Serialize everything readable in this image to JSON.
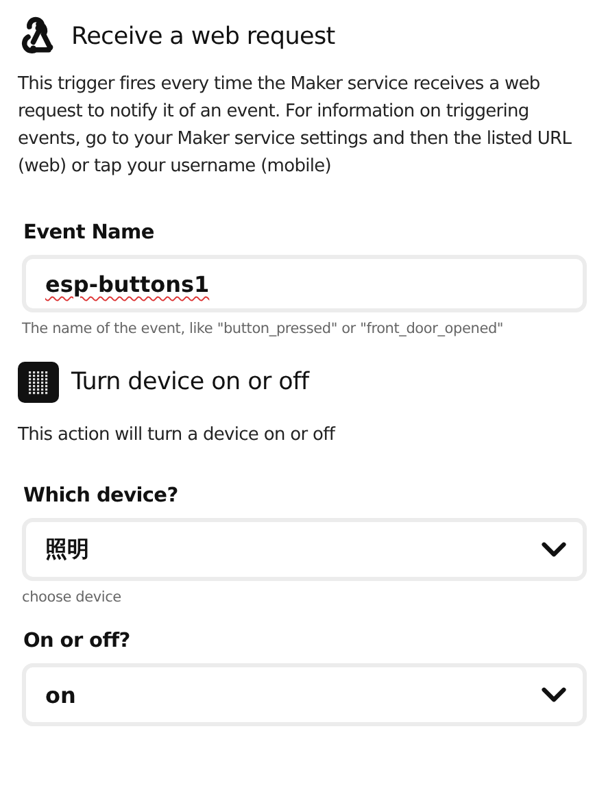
{
  "sections": [
    {
      "kind": "webhook",
      "title": "Receive a web request",
      "description": "This trigger fires every time the Maker service receives a web request to notify it of an event. For information on triggering events, go to your Maker service settings and then the listed URL (web) or tap your username (mobile)",
      "fields": [
        {
          "kind": "text",
          "label": "Event Name",
          "value": "esp-buttons1",
          "hint": "The name of the event, like \"button_pressed\" or \"front_door_opened\""
        }
      ]
    },
    {
      "kind": "device",
      "title": "Turn device on or off",
      "description": "This action will turn a device on or off",
      "fields": [
        {
          "kind": "select",
          "label": "Which device?",
          "value": "照明",
          "hint": "choose device"
        },
        {
          "kind": "select",
          "label": "On or off?",
          "value": "on"
        }
      ]
    }
  ]
}
